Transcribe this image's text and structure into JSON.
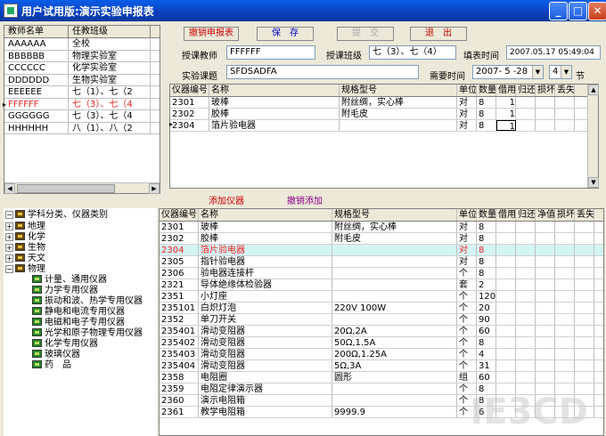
{
  "window": {
    "title": "用户试用版:演示实验申报表",
    "min": "_",
    "max": "□",
    "close": "✕"
  },
  "teacher_list": {
    "headers": [
      "教师名单",
      "任教班级"
    ],
    "rows": [
      [
        "AAAAAA",
        "全校"
      ],
      [
        "BBBBBB",
        "物理实验室"
      ],
      [
        "CCCCCC",
        "化学实验室"
      ],
      [
        "DDDDDD",
        "生物实验室"
      ],
      [
        "EEEEEE",
        "七（1）、七（2"
      ],
      [
        "FFFFFF",
        "七（3）、七（4"
      ],
      [
        "GGGGGG",
        "七（3）、七（4"
      ],
      [
        "HHHHHH",
        "八（1）、八（2"
      ]
    ]
  },
  "toolbar": {
    "revoke": "撤销申报表",
    "save": "保　存",
    "submit": "提　交",
    "exit": "退　出"
  },
  "form": {
    "teacher_label": "授课教师",
    "teacher_value": "FFFFFF",
    "class_label": "授课班级",
    "class_value": "七（3）、七（4）",
    "fill_time_label": "填表时间",
    "fill_time_value": "2007.05.17 05:49:04",
    "topic_label": "实验课题",
    "topic_value": "SFDSADFA",
    "need_time_label": "需要时间",
    "need_date": "2007- 5 -28",
    "period": "4",
    "period_unit": "节"
  },
  "request_grid": {
    "headers": [
      "仪器编号",
      "名称",
      "规格型号",
      "单位",
      "数量",
      "借用",
      "归还",
      "损坏",
      "丢失"
    ],
    "rows": [
      [
        "2301",
        "玻棒",
        "附丝绸，实心棒",
        "对",
        "8",
        "1",
        "",
        "",
        ""
      ],
      [
        "2302",
        "胶棒",
        "附毛皮",
        "对",
        "8",
        "1",
        "",
        "",
        ""
      ],
      [
        "2304",
        "箔片验电器",
        "",
        "对",
        "8",
        "1",
        "",
        "",
        ""
      ]
    ]
  },
  "mid": {
    "add": "添加仪器",
    "undo_add": "撤销添加"
  },
  "tree": {
    "root": "学科分类、仪器类别",
    "subjects": [
      "地理",
      "化学",
      "生物",
      "天文",
      "物理"
    ],
    "physics_children": [
      "计量、通用仪器",
      "力学专用仪器",
      "振动和波、热学专用仪器",
      "静电和电流专用仪器",
      "电磁和电子专用仪器",
      "光学和原子物理专用仪器",
      "化学专用仪器",
      "玻璃仪器",
      "药　品"
    ]
  },
  "catalog_grid": {
    "headers": [
      "仪器编号",
      "名称",
      "规格型号",
      "单位",
      "数量",
      "借用",
      "归还",
      "净值",
      "损坏",
      "丢失"
    ],
    "rows": [
      [
        "2301",
        "玻棒",
        "附丝绸，实心棒",
        "对",
        "8"
      ],
      [
        "2302",
        "胶棒",
        "附毛皮",
        "对",
        "8"
      ],
      [
        "2304",
        "箔片验电器",
        "",
        "对",
        "8"
      ],
      [
        "2305",
        "指针验电器",
        "",
        "对",
        "8"
      ],
      [
        "2306",
        "验电器连接杆",
        "",
        "个",
        "8"
      ],
      [
        "2321",
        "导体绝缘体检验器",
        "",
        "套",
        "2"
      ],
      [
        "2351",
        "小灯座",
        "",
        "个",
        "120"
      ],
      [
        "235101",
        "白炽灯泡",
        "220V 100W",
        "个",
        "20"
      ],
      [
        "2352",
        "单刀开关",
        "",
        "个",
        "90"
      ],
      [
        "235401",
        "滑动变阻器",
        "20Ω,2A",
        "个",
        "60"
      ],
      [
        "235402",
        "滑动变阻器",
        "50Ω,1.5A",
        "个",
        "8"
      ],
      [
        "235403",
        "滑动变阻器",
        "200Ω,1.25A",
        "个",
        "4"
      ],
      [
        "235404",
        "滑动变阻器",
        "5Ω,3A",
        "个",
        "31"
      ],
      [
        "2358",
        "电阻圈",
        "圆形",
        "组",
        "60"
      ],
      [
        "2359",
        "电阻定律演示器",
        "",
        "个",
        "8"
      ],
      [
        "2360",
        "演示电阻箱",
        "",
        "个",
        "8"
      ],
      [
        "2361",
        "教学电阻箱",
        "9999.9",
        "个",
        "6"
      ]
    ]
  },
  "watermark": "IE3CD"
}
